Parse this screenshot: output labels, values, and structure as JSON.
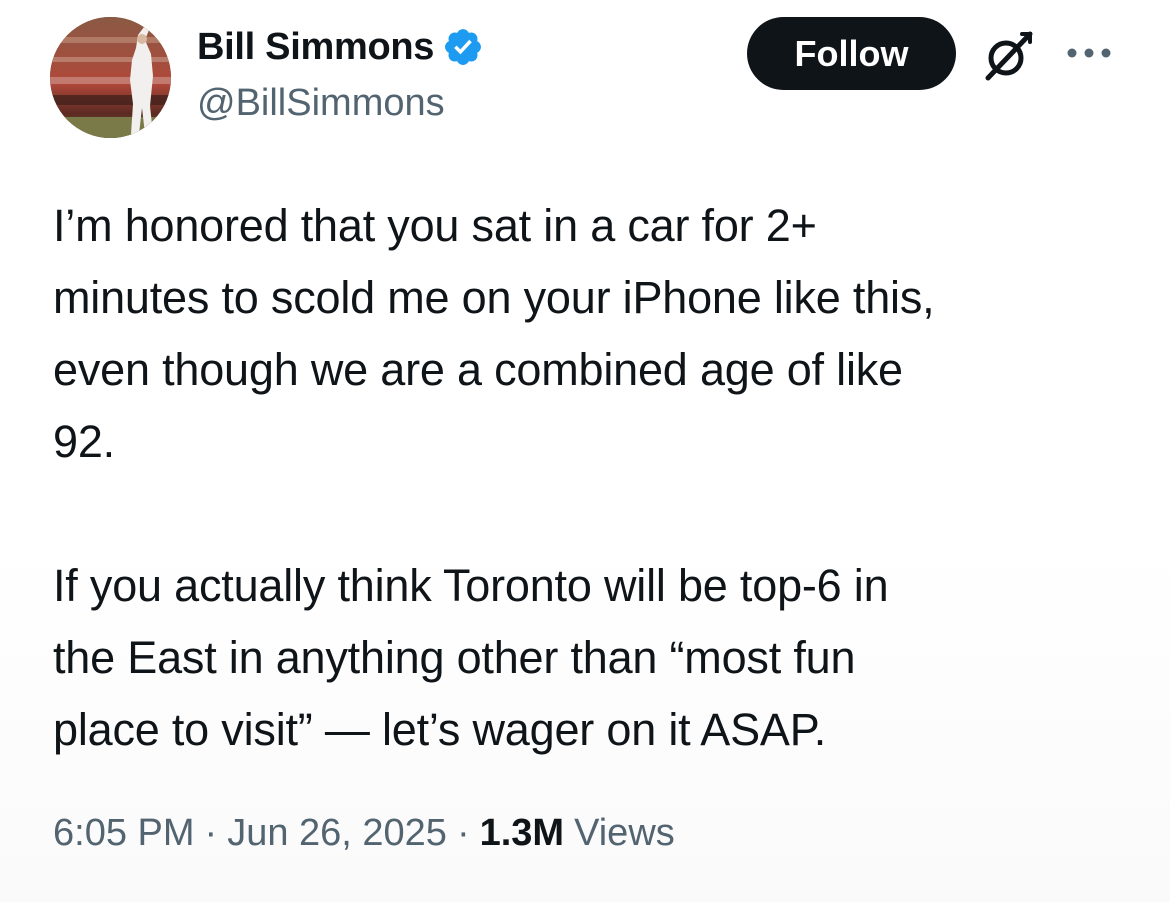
{
  "author": {
    "display_name": "Bill Simmons",
    "handle": "@BillSimmons",
    "verified": true
  },
  "actions": {
    "follow_label": "Follow"
  },
  "icons": {
    "verified": "verified-badge-icon",
    "grok": "grok-icon",
    "more": "more-options-icon"
  },
  "tweet": {
    "text": "I’m honored that you sat in a car for 2+\nminutes to scold me on your iPhone like this,\neven though we are a combined age of like\n92.\n\nIf you actually think Toronto will be top-6 in\nthe East in anything other than “most fun\nplace to visit” — let’s wager on it ASAP."
  },
  "meta": {
    "time": "6:05 PM",
    "date": "Jun 26, 2025",
    "separator": "·",
    "views_count": "1.3M",
    "views_label": "Views"
  },
  "colors": {
    "text": "#0f1419",
    "secondary": "#536471",
    "verified_blue": "#1d9bf0",
    "button_bg": "#0f1419"
  }
}
